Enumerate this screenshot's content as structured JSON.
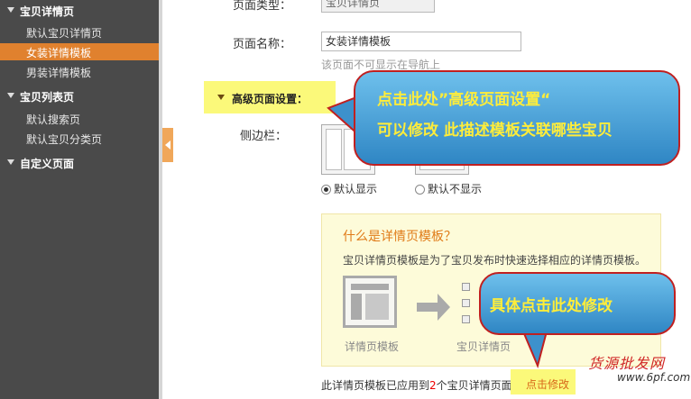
{
  "sidebar": {
    "groups": [
      {
        "label": "宝贝详情页",
        "items": [
          "默认宝贝详情页",
          "女装详情模板",
          "男装详情模板"
        ]
      },
      {
        "label": "宝贝列表页",
        "items": [
          "默认搜索页",
          "默认宝贝分类页"
        ]
      },
      {
        "label": "自定义页面",
        "items": []
      }
    ],
    "active_item": "女装详情模板"
  },
  "form": {
    "page_type_label": "页面类型：",
    "page_type_value": "宝贝详情页",
    "page_name_label": "页面名称：",
    "page_name_value": "女装详情模板",
    "page_name_hint": "该页面不可显示在导航上",
    "advanced_label": "高级页面设置：",
    "sidebar_label": "侧边栏：",
    "radio_default_show": "默认显示",
    "radio_default_hide": "默认不显示"
  },
  "info": {
    "title": "什么是详情页模板？",
    "desc": "宝贝详情页模板是为了宝贝发布时快速选择相应的详情页模板。",
    "template_caption": "详情页模板",
    "item_caption": "宝贝详情页",
    "applied_prefix": "此详情页模板已应用到",
    "applied_count": "2",
    "applied_suffix": "个宝贝详情页面。",
    "edit_link": "点击修改"
  },
  "callouts": {
    "top_line1": "点击此处”高级页面设置“",
    "top_line2": "可以修改 此描述模板关联哪些宝贝",
    "bottom": "具体点击此处修改"
  },
  "watermark": {
    "line1": "货源批发网",
    "line2": "www.6pf.com"
  },
  "colors": {
    "sidebar_bg": "#4a4a4a",
    "active": "#e0812e",
    "highlight": "#fbf97a",
    "callout_text": "#ffed3a",
    "callout_border": "#c02020"
  }
}
